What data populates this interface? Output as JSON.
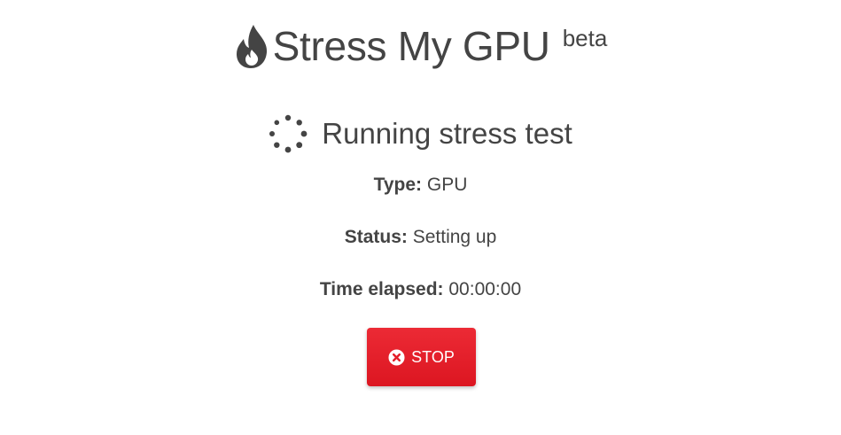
{
  "header": {
    "title": "Stress My GPU",
    "badge": "beta",
    "logo_icon": "flame-icon"
  },
  "test": {
    "heading": "Running stress test",
    "spinner_icon": "loading-spinner-icon",
    "type_label": "Type:",
    "type_value": "GPU",
    "status_label": "Status:",
    "status_value": "Setting up",
    "time_label": "Time elapsed:",
    "time_value": "00:00:00"
  },
  "actions": {
    "stop_label": "STOP",
    "stop_icon": "close-circle-icon"
  },
  "colors": {
    "text": "#444444",
    "stop_button": "#e41e29",
    "background": "#ffffff"
  }
}
